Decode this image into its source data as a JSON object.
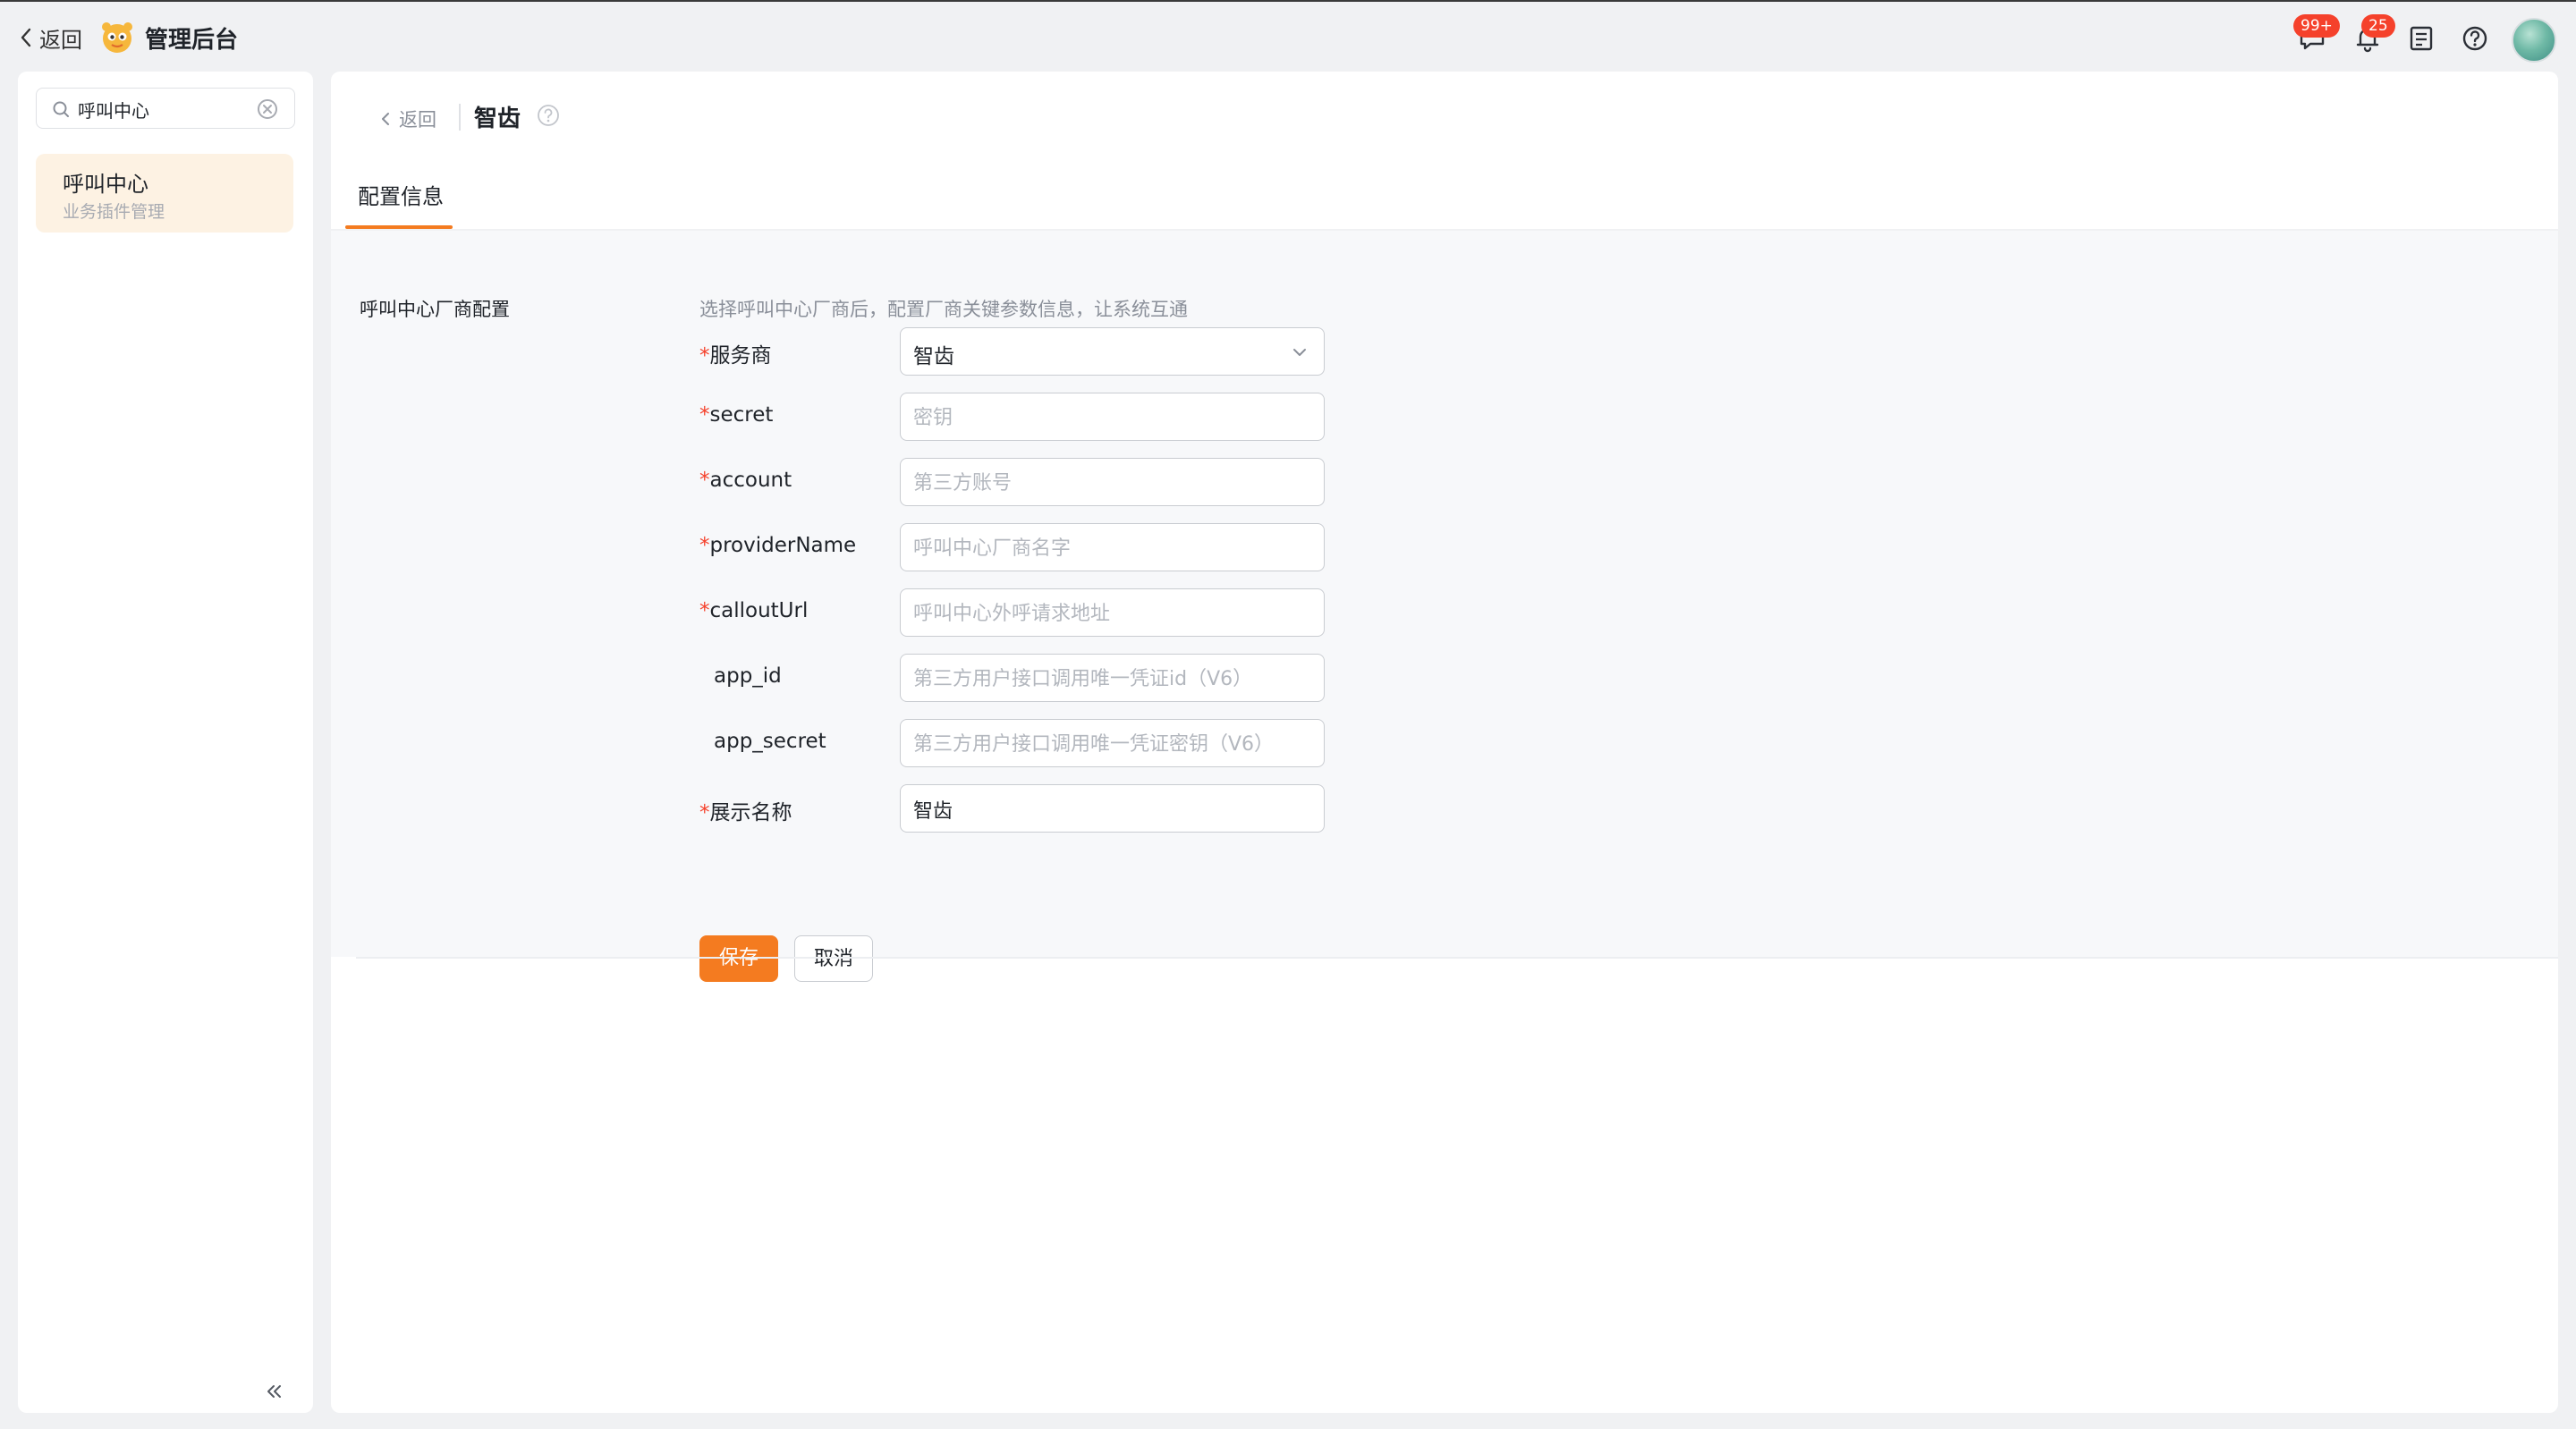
{
  "topbar": {
    "back_label": "返回",
    "app_title": "管理后台",
    "messages_badge": "99+",
    "notifications_badge": "25"
  },
  "sidebar": {
    "search_value": "呼叫中心",
    "items": [
      {
        "title": "呼叫中心",
        "subtitle": "业务插件管理"
      }
    ]
  },
  "main": {
    "back_label": "返回",
    "page_title": "智齿",
    "tabs": [
      {
        "label": "配置信息"
      }
    ],
    "section": {
      "title": "呼叫中心厂商配置",
      "description": "选择呼叫中心厂商后，配置厂商关键参数信息，让系统互通"
    },
    "form": {
      "fields": [
        {
          "label": "服务商",
          "required": true,
          "type": "select",
          "value": "智齿",
          "placeholder": ""
        },
        {
          "label": "secret",
          "required": true,
          "type": "input",
          "value": "",
          "placeholder": "密钥"
        },
        {
          "label": "account",
          "required": true,
          "type": "input",
          "value": "",
          "placeholder": "第三方账号"
        },
        {
          "label": "providerName",
          "required": true,
          "type": "input",
          "value": "",
          "placeholder": "呼叫中心厂商名字"
        },
        {
          "label": "calloutUrl",
          "required": true,
          "type": "input",
          "value": "",
          "placeholder": "呼叫中心外呼请求地址"
        },
        {
          "label": "app_id",
          "required": false,
          "type": "input",
          "value": "",
          "placeholder": "第三方用户接口调用唯一凭证id（V6）"
        },
        {
          "label": "app_secret",
          "required": false,
          "type": "input",
          "value": "",
          "placeholder": "第三方用户接口调用唯一凭证密钥（V6）"
        },
        {
          "label": "展示名称",
          "required": true,
          "type": "input",
          "value": "智齿",
          "placeholder": ""
        }
      ],
      "required_mark": "*",
      "save_label": "保存",
      "cancel_label": "取消"
    }
  },
  "colors": {
    "accent": "#f47b20",
    "required": "#f5412b",
    "badge": "#f5412b",
    "active_item_bg": "#fdf2e3"
  }
}
